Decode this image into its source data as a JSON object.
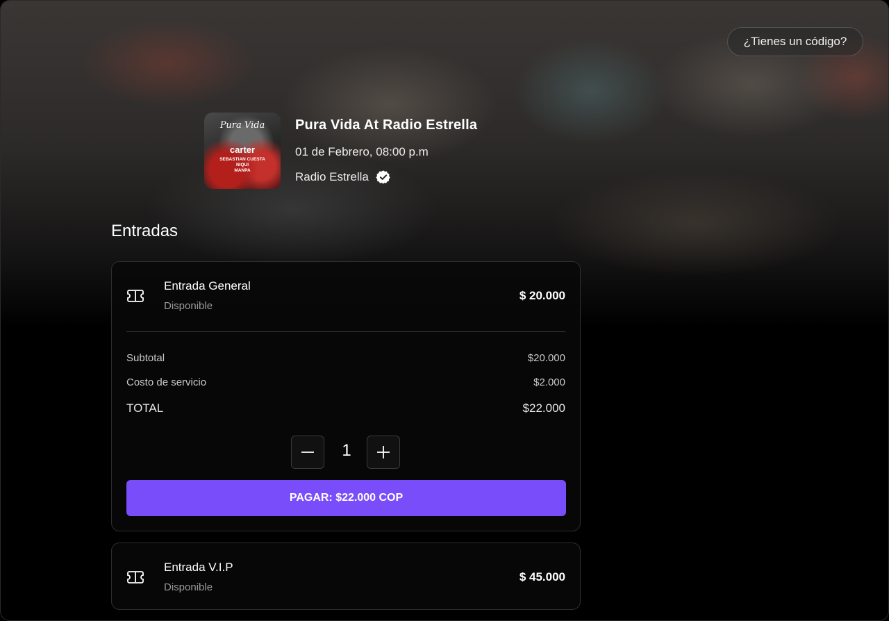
{
  "header": {
    "code_button": "¿Tienes un código?"
  },
  "event": {
    "title": "Pura Vida At Radio Estrella",
    "date": "01 de Febrero, 08:00 p.m",
    "venue": "Radio Estrella",
    "poster": {
      "logo": "Pura Vida",
      "headliner": "carter",
      "lineup": [
        "SEBASTIAN CUESTA",
        "NIQUI",
        "MANPA"
      ]
    }
  },
  "tickets": {
    "section_title": "Entradas",
    "items": [
      {
        "name": "Entrada General",
        "status": "Disponible",
        "price": "$ 20.000"
      },
      {
        "name": "Entrada V.I.P",
        "status": "Disponible",
        "price": "$ 45.000"
      }
    ],
    "summary": {
      "subtotal_label": "Subtotal",
      "subtotal_value": "$20.000",
      "service_label": "Costo de servicio",
      "service_value": "$2.000",
      "total_label": "TOTAL",
      "total_value": "$22.000"
    },
    "quantity": "1",
    "pay_button": "PAGAR: $22.000 COP"
  },
  "colors": {
    "accent": "#7a4dfa",
    "background": "#000000"
  },
  "icons": {
    "ticket": "ticket-icon",
    "verified": "verified-badge-icon",
    "minus": "minus-icon",
    "plus": "plus-icon"
  }
}
